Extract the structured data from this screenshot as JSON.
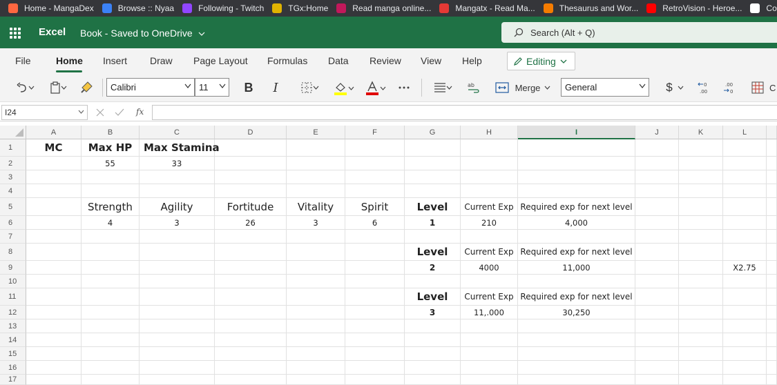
{
  "browser": {
    "bookmarks": [
      {
        "label": "Home - MangaDex",
        "icon": "mangadex-icon",
        "color": "#ff6740"
      },
      {
        "label": "Browse :: Nyaa",
        "icon": "nyaa-icon",
        "color": "#3b82f6"
      },
      {
        "label": "Following - Twitch",
        "icon": "twitch-icon",
        "color": "#9146ff"
      },
      {
        "label": "TGx:Home",
        "icon": "tgx-icon",
        "color": "#e0b300"
      },
      {
        "label": "Read manga online...",
        "icon": "manga-icon",
        "color": "#c2185b"
      },
      {
        "label": "Mangatx - Read Ma...",
        "icon": "mangatx-icon",
        "color": "#e53935"
      },
      {
        "label": "Thesaurus and Wor...",
        "icon": "thesaurus-icon",
        "color": "#f57c00"
      },
      {
        "label": "RetroVision - Heroe...",
        "icon": "youtube-icon",
        "color": "#ff0000"
      },
      {
        "label": "Con",
        "icon": "document-icon",
        "color": "#ffffff"
      }
    ]
  },
  "excel": {
    "app_name": "Excel",
    "book_title": "Book - Saved to OneDrive",
    "search_placeholder": "Search (Alt + Q)",
    "accent": "#1f7245"
  },
  "ribbon": {
    "tabs": [
      "File",
      "Home",
      "Insert",
      "Draw",
      "Page Layout",
      "Formulas",
      "Data",
      "Review",
      "View",
      "Help"
    ],
    "active_tab": "Home",
    "editing_label": "Editing"
  },
  "toolbar": {
    "font": "Calibri",
    "size": "11",
    "bold": "B",
    "italic": "I",
    "merge_label": "Merge",
    "number_format": "General",
    "currency": "$",
    "trailing": "C"
  },
  "formula_bar": {
    "name_box": "I24",
    "fx": "fx",
    "value": ""
  },
  "sheet": {
    "selected_column": "I",
    "columns": [
      "A",
      "B",
      "C",
      "D",
      "E",
      "F",
      "G",
      "H",
      "I",
      "J",
      "K",
      "L"
    ],
    "rows": [
      "1",
      "2",
      "3",
      "4",
      "5",
      "6",
      "7",
      "8",
      "9",
      "10",
      "11",
      "12",
      "13",
      "14",
      "15",
      "16",
      "17"
    ],
    "cells": {
      "A1": "MC",
      "B1": "Max HP",
      "C1": "Max Stamina",
      "B2": "55",
      "C2": "33",
      "B5": "Strength",
      "C5": "Agility",
      "D5": "Fortitude",
      "E5": "Vitality",
      "F5": "Spirit",
      "G5": "Level",
      "H5": "Current Exp",
      "I5": "Required exp for next level",
      "B6": "4",
      "C6": "3",
      "D6": "26",
      "E6": "3",
      "F6": "6",
      "G6": "1",
      "H6": "210",
      "I6": "4,000",
      "G8": "Level",
      "H8": "Current Exp",
      "I8": "Required exp for next level",
      "G9": "2",
      "H9": "4000",
      "I9": "11,000",
      "L9": "X2.75",
      "G11": "Level",
      "H11": "Current Exp",
      "I11": "Required exp for next level",
      "G12": "3",
      "H12": "11,.000",
      "I12": "30,250"
    }
  }
}
